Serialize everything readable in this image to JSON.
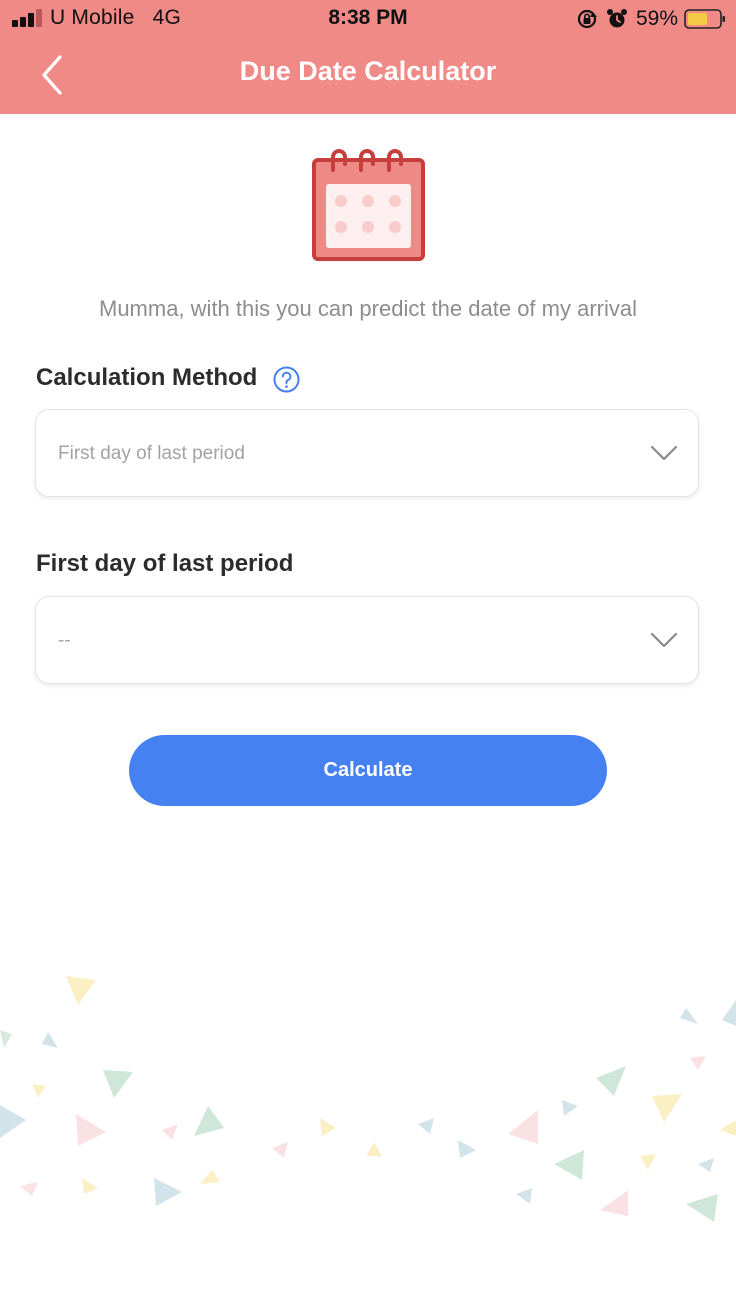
{
  "status_bar": {
    "carrier": "U Mobile",
    "network": "4G",
    "time": "8:38 PM",
    "battery_percent": "59%",
    "icons": [
      "signal-icon",
      "orientation-lock-icon",
      "alarm-icon",
      "battery-icon"
    ]
  },
  "header": {
    "title": "Due Date Calculator",
    "back_icon": "chevron-left-icon",
    "background_color": "#F08A87"
  },
  "main": {
    "illustration": "calendar-icon",
    "tagline": "Mumma, with this you can predict the date of my arrival",
    "method_label": "Calculation Method",
    "help_icon": "question-circle-icon",
    "method_select": {
      "value": "First day of last period"
    },
    "period_label": "First day of last period",
    "period_select": {
      "value": "--"
    },
    "calculate_label": "Calculate",
    "accent_color": "#4681F2"
  }
}
